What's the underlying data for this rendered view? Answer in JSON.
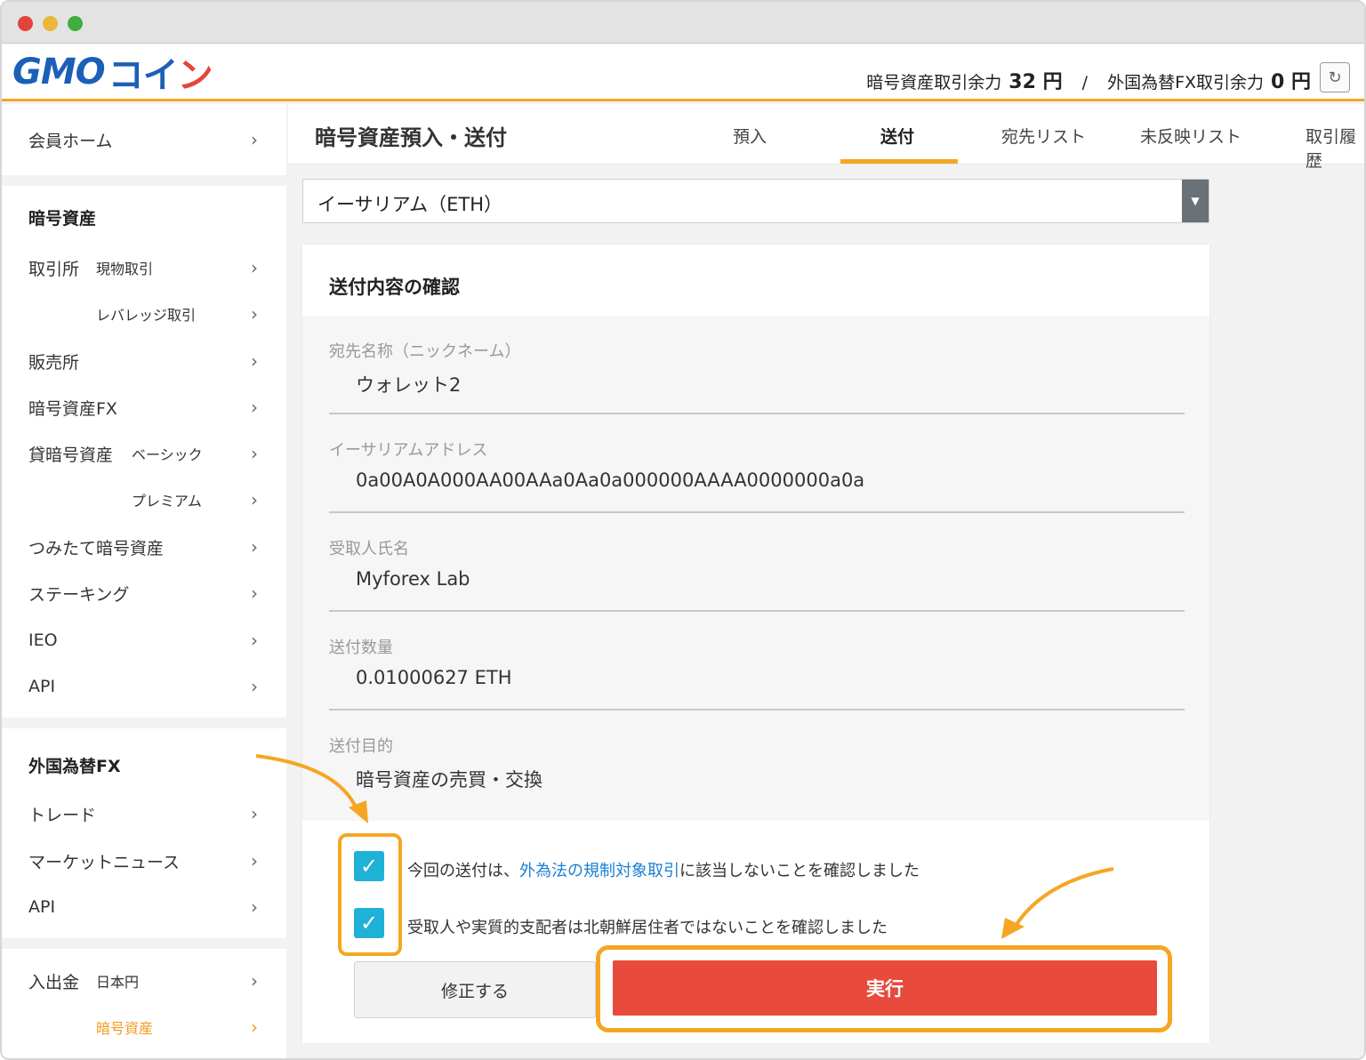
{
  "header": {
    "logo_main": "GMO",
    "logo_coin": "コイ",
    "logo_coin_accent": "ン",
    "crypto_balance_label": "暗号資産取引余力",
    "crypto_balance_value": "32 円",
    "separator": "/",
    "fx_balance_label": "外国為替FX取引余力",
    "fx_balance_value": "0 円",
    "refresh_icon": "↻"
  },
  "sidebar": {
    "member_home": "会員ホーム",
    "crypto_heading": "暗号資産",
    "exchange": "取引所",
    "exchange_spot": "現物取引",
    "exchange_leverage": "レバレッジ取引",
    "sales": "販売所",
    "crypto_fx": "暗号資産FX",
    "lending": "貸暗号資産",
    "lending_basic": "ベーシック",
    "lending_premium": "プレミアム",
    "tsumitate": "つみたて暗号資産",
    "staking": "ステーキング",
    "ieo": "IEO",
    "api": "API",
    "fx_heading": "外国為替FX",
    "trade": "トレード",
    "market_news": "マーケットニュース",
    "fx_api": "API",
    "deposit_withdraw": "入出金",
    "dw_jpy": "日本円",
    "dw_crypto": "暗号資産",
    "chevron": "›"
  },
  "main": {
    "page_title": "暗号資産預入・送付",
    "tabs": [
      "預入",
      "送付",
      "宛先リスト",
      "未反映リスト",
      "取引履歴"
    ],
    "active_tab": "送付",
    "currency_select": "イーサリアム（ETH）",
    "card_title": "送付内容の確認",
    "fields": [
      {
        "label": "宛先名称（ニックネーム）",
        "value": "ウォレット2"
      },
      {
        "label": "イーサリアムアドレス",
        "value": "0a00A0A000AA00AAa0Aa0a000000AAAA0000000a0a"
      },
      {
        "label": "受取人氏名",
        "value": "Myforex Lab"
      },
      {
        "label": "送付数量",
        "value": "0.01000627 ETH"
      },
      {
        "label": "送付目的",
        "value": "暗号資産の売買・交換"
      }
    ],
    "check1_prefix": "今回の送付は、",
    "check1_link": "外為法の規制対象取引",
    "check1_suffix": "に該当しないことを確認しました",
    "check2": "受取人や実質的支配者は北朝鮮居住者ではないことを確認しました",
    "edit_button": "修正する",
    "execute_button": "実行"
  },
  "colors": {
    "accent_orange": "#f5a623",
    "execute_red": "#e84a3c",
    "checkbox_cyan": "#1fb2d6",
    "brand_blue": "#1c5fb8"
  }
}
